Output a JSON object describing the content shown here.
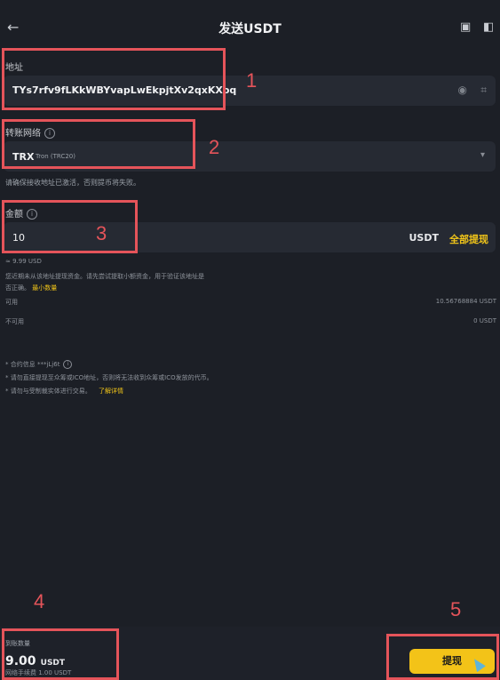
{
  "header": {
    "title": "发送USDT",
    "back_icon": "←",
    "history_icon": "▣",
    "settings_icon": "◧"
  },
  "address": {
    "label": "地址",
    "value": "TYs7rfv9fLKkWBYvapLwEkpjtXv2qxKXoq",
    "contact_icon": "◉",
    "scan_icon": "⌗"
  },
  "network": {
    "label": "转账网络",
    "selected_code": "TRX",
    "selected_name": "Tron (TRC20)",
    "hint": "请确保接收地址已激活，否则提币将失败。",
    "chevron_icon": "▾"
  },
  "amount": {
    "label": "金额",
    "value": "10",
    "unit": "USDT",
    "max_label": "全部提现",
    "converted": "≈ 9.99 USD",
    "notice_line1": "您近期未从该地址提现资金。请先尝试提取小额资金，用于验证该地址是",
    "notice_line2": "否正确。",
    "notice_link": "最小数量",
    "available_label": "可用",
    "available_value": "10.56768884 USDT",
    "unavailable_label": "不可用",
    "unavailable_value": "0 USDT"
  },
  "warnings": {
    "line1": "* 合约信息 ***jLj6t",
    "line2": "* 请勿直接提现至众筹或ICO地址，否则将无法收到众筹或ICO发放的代币。",
    "line3": "* 请勿与受制裁实体进行交易。",
    "line3_link": "了解详情"
  },
  "footer": {
    "receive_label": "到账数量",
    "receive_value": "9.00",
    "receive_unit": "USDT",
    "fee_text": "网络手续费 1.00 USDT",
    "submit_label": "提现"
  },
  "annotations": {
    "n1": "1",
    "n2": "2",
    "n3": "3",
    "n4": "4",
    "n5": "5"
  },
  "colors": {
    "background": "#1c1f26",
    "field": "#262a33",
    "accent": "#f3c318",
    "annotation": "#e5545a"
  }
}
